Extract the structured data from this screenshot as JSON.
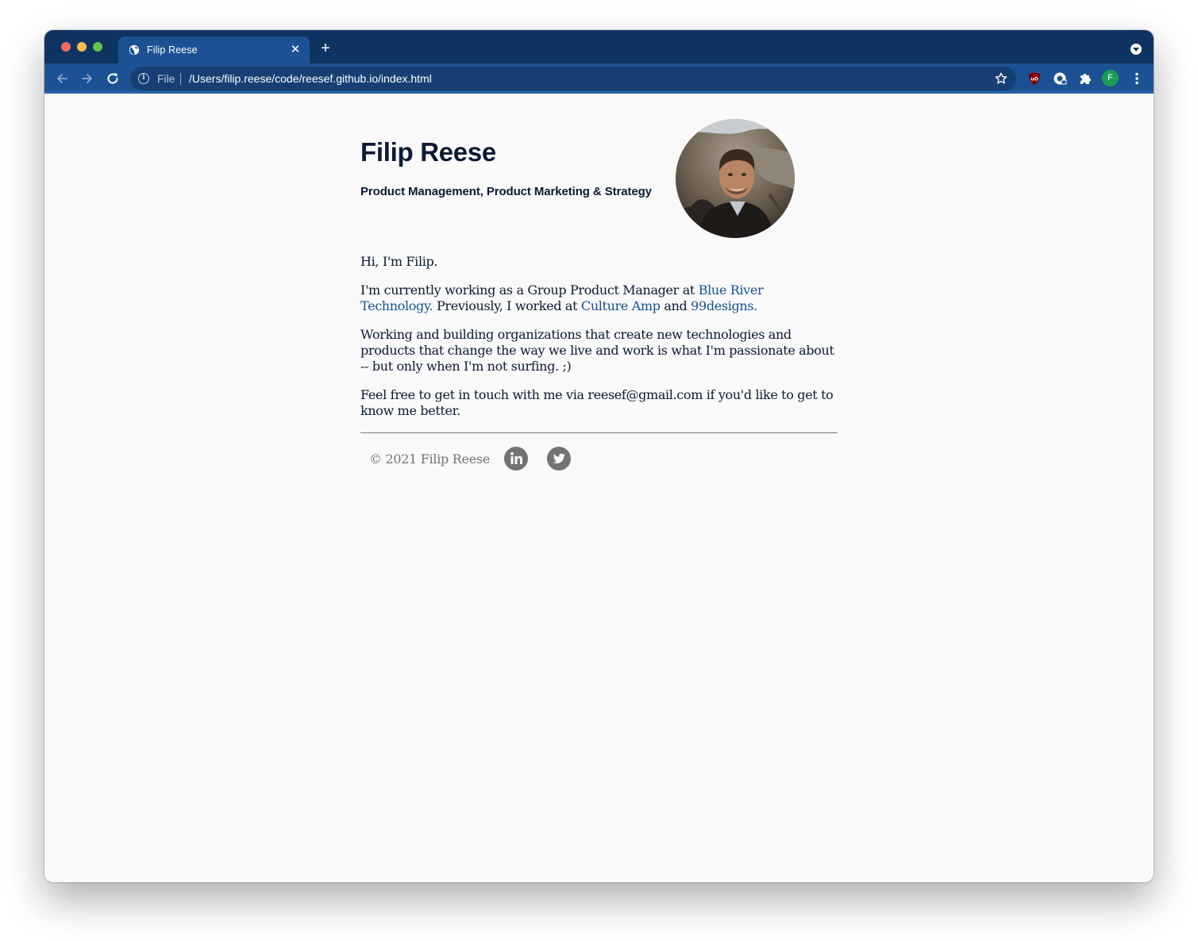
{
  "browser": {
    "tab": {
      "title": "Filip Reese"
    },
    "omnibox": {
      "scheme_label": "File",
      "url": "/Users/filip.reese/code/reesef.github.io/index.html"
    },
    "profile_initial": "F",
    "colors": {
      "tabstrip": "#0f3461",
      "toolbar": "#1c5294",
      "active_tab": "#1c5294"
    }
  },
  "page": {
    "name": "Filip Reese",
    "subtitle": "Product Management, Product Marketing & Strategy",
    "intro": "Hi, I'm Filip.",
    "work": {
      "prefix": "I'm currently working as a Group Product Manager at ",
      "link1": "Blue River Technology.",
      "middle": " Previously, I worked at ",
      "link2": "Culture Amp",
      "and": " and ",
      "link3": "99designs."
    },
    "passion": "Working and building organizations that create new technologies and products that change the way we live and work is what I'm passionate about -- but only when I'm not surfing. ;)",
    "contact": "Feel free to get in touch with me via reesef@gmail.com if you'd like to get to know me better.",
    "footer": {
      "copyright": "© 2021 Filip Reese",
      "social_icons": [
        "linkedin-icon",
        "twitter-icon"
      ]
    },
    "colors": {
      "text": "#0c1a33",
      "link": "#175192",
      "muted": "#737373"
    }
  }
}
